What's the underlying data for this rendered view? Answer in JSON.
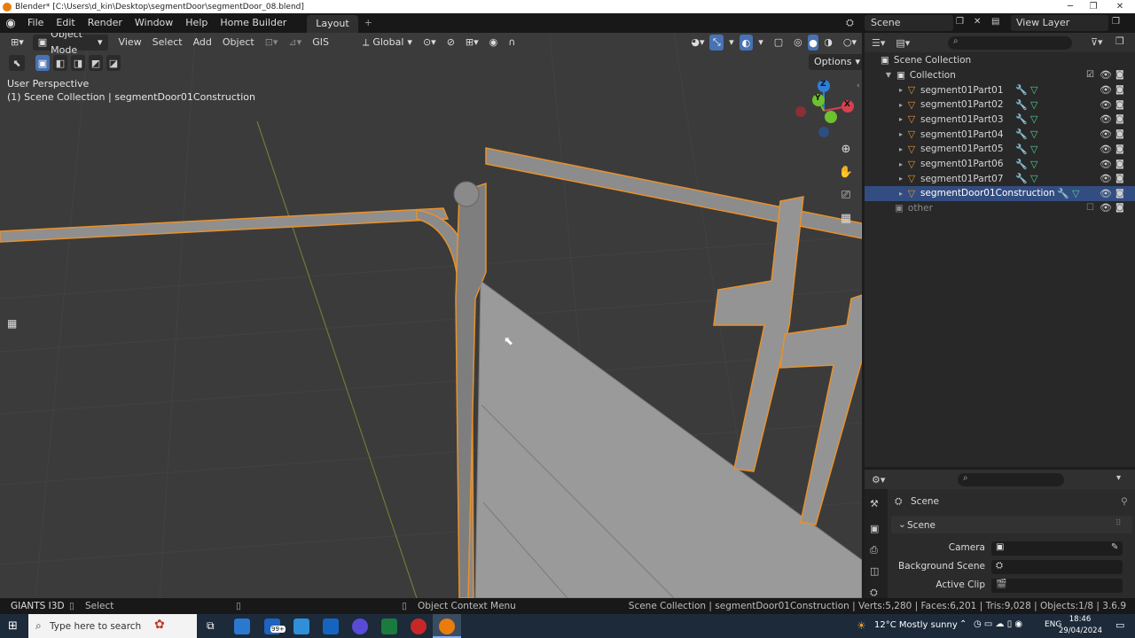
{
  "titlebar": {
    "title": "Blender* [C:\\Users\\d_kin\\Desktop\\segmentDoor\\segmentDoor_08.blend]",
    "minimize": "─",
    "restore": "❐",
    "close": "✕"
  },
  "menubar": {
    "items": [
      "File",
      "Edit",
      "Render",
      "Window",
      "Help",
      "Home Builder"
    ],
    "active_tab": "Layout",
    "add_tab": "+",
    "scene_label": "Scene",
    "view_layer_label": "View Layer"
  },
  "viewport": {
    "mode": "Object Mode",
    "menus": [
      "View",
      "Select",
      "Add",
      "Object"
    ],
    "gis": "GIS",
    "transform_orientation": "Global",
    "options": "Options",
    "perspective": "User Perspective",
    "context": "(1) Scene Collection | segmentDoor01Construction",
    "gizmo": {
      "z": "Z",
      "y": "Y",
      "x": "X"
    }
  },
  "outliner": {
    "scene_collection": "Scene Collection",
    "collection": "Collection",
    "objects": [
      "segment01Part01",
      "segment01Part02",
      "segment01Part03",
      "segment01Part04",
      "segment01Part05",
      "segment01Part06",
      "segment01Part07",
      "segmentDoor01Construction"
    ],
    "selected_index": 7,
    "other": "other"
  },
  "properties": {
    "header": "Scene",
    "panel": "Scene",
    "fields": [
      "Camera",
      "Background Scene",
      "Active Clip"
    ]
  },
  "statusbar": {
    "addon": "GIANTS I3D",
    "select": "Select",
    "context_menu": "Object Context Menu",
    "stats": "Scene Collection | segmentDoor01Construction | Verts:5,280 | Faces:6,201 | Tris:9,028 | Objects:1/8 | 3.6.9"
  },
  "taskbar": {
    "search_placeholder": "Type here to search",
    "mail_badge": "99+",
    "weather": "12°C  Mostly sunny",
    "lang": "ENG",
    "time": "18:46",
    "date": "29/04/2024"
  },
  "colors": {
    "selection_outline": "#e8912b",
    "viewport_bg": "#3b3b3b",
    "accent": "#4772b3",
    "mesh_icon": "#e09030"
  }
}
